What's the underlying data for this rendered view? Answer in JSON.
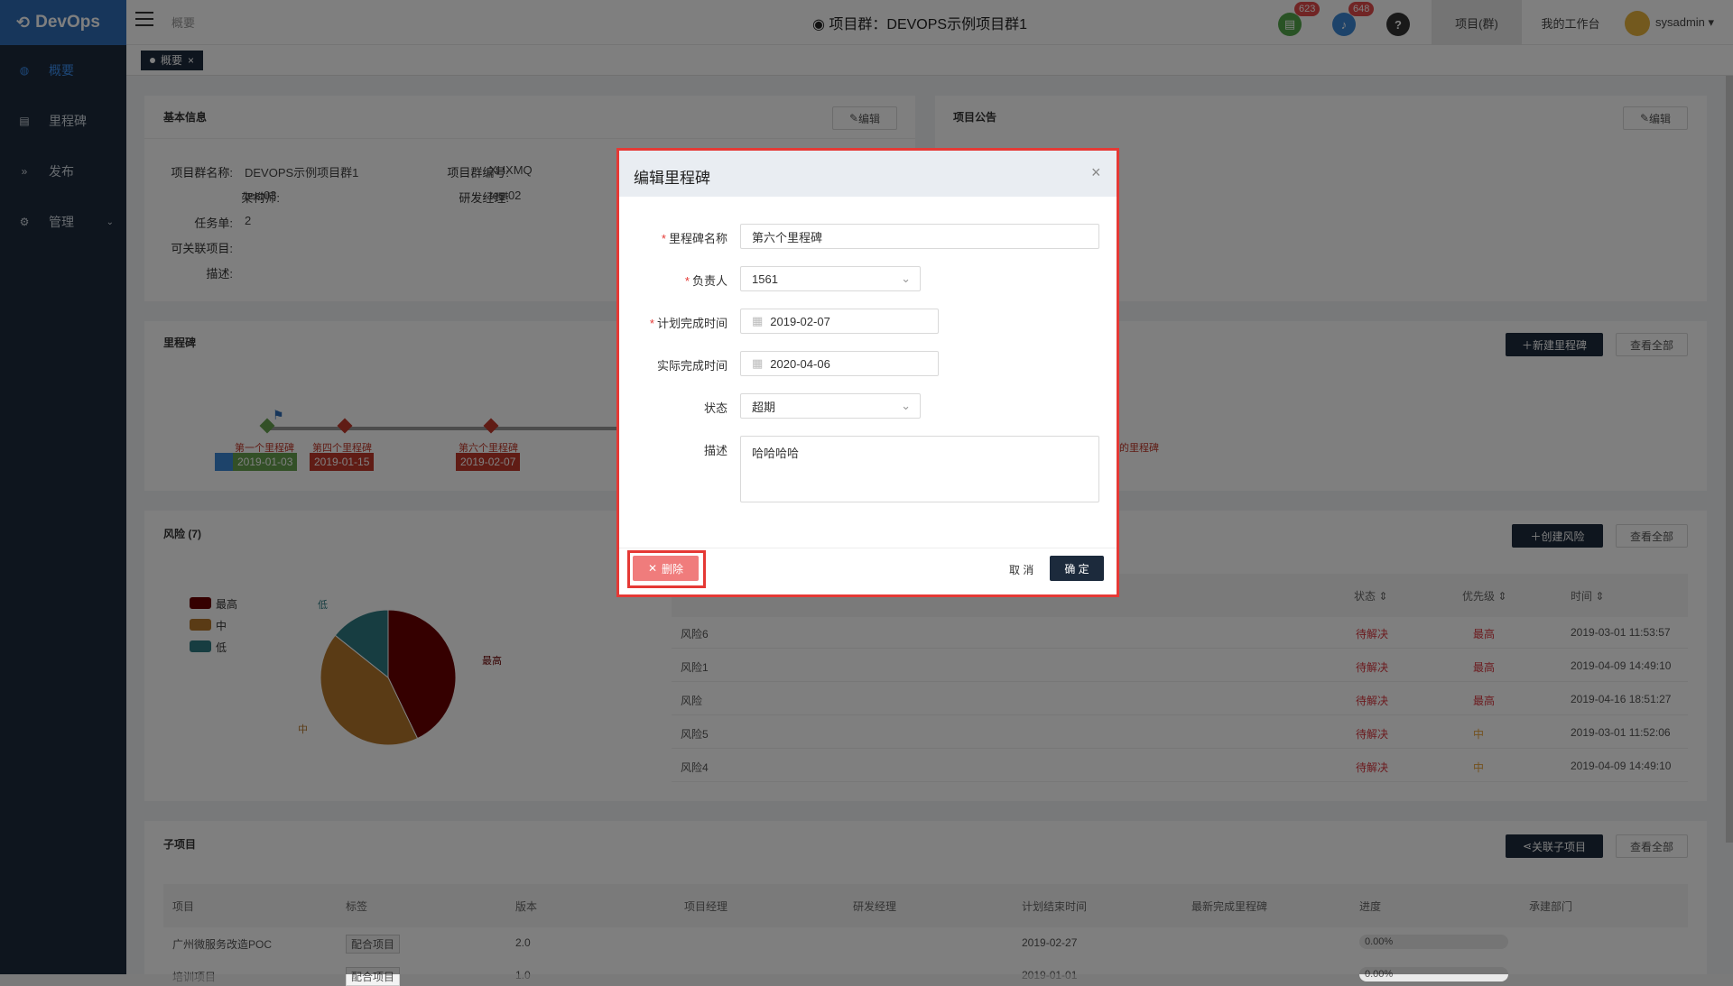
{
  "app": {
    "name": "DevOps"
  },
  "header": {
    "breadcrumb": "概要",
    "title": "项目群：DEVOPS示例项目群1",
    "doc_badge": "623",
    "bell_badge": "648",
    "help": "?",
    "nav_project_group": "项目(群)",
    "nav_workbench": "我的工作台",
    "user": "sysadmin"
  },
  "sidebar": {
    "items": [
      {
        "label": "概要",
        "icon": "dashboard-icon"
      },
      {
        "label": "里程碑",
        "icon": "calendar-icon"
      },
      {
        "label": "发布",
        "icon": "forward-icon"
      },
      {
        "label": "管理",
        "icon": "gear-icon"
      }
    ]
  },
  "tabs": {
    "active": "概要",
    "close": "×"
  },
  "basic_info": {
    "title": "基本信息",
    "edit": "编辑",
    "fields": {
      "name_label": "项目群名称:",
      "name_value": "DEVOPS示例项目群1",
      "code_label": "项目群编号:",
      "code_value": "XHXMQ",
      "architect_label": "架构师:",
      "architect_value": "test03",
      "manager_label": "研发经理:",
      "manager_value": "test02",
      "tasks_label": "任务单:",
      "tasks_value": "2",
      "linkable_label": "可关联项目:",
      "desc_label": "描述:"
    }
  },
  "announcement": {
    "title": "项目公告",
    "edit": "编辑"
  },
  "milestones": {
    "title": "里程碑",
    "new_button": "新建里程碑",
    "view_all": "查看全部",
    "items": [
      {
        "name": "第一个里程碑",
        "date": "2019-01-03"
      },
      {
        "name": "第四个里程碑",
        "date": "2019-01-15"
      },
      {
        "name": "第六个里程碑",
        "date": "2019-02-07"
      }
    ],
    "right_label": "的里程碑"
  },
  "risk": {
    "title": "风险 (7)",
    "create_button": "创建风险",
    "view_all": "查看全部",
    "legend": [
      {
        "name": "最高",
        "color": "#6b0000"
      },
      {
        "name": "中",
        "color": "#b5762a"
      },
      {
        "name": "低",
        "color": "#2f7b83"
      }
    ],
    "pie_labels": {
      "high": "最高",
      "mid": "中",
      "low": "低"
    },
    "columns": {
      "status": "状态",
      "priority": "优先级",
      "time": "时间"
    },
    "rows": [
      {
        "name": "风险6",
        "status": "待解决",
        "priority": "最高",
        "time": "2019-03-01 11:53:57"
      },
      {
        "name": "风险1",
        "status": "待解决",
        "priority": "最高",
        "time": "2019-04-09 14:49:10"
      },
      {
        "name": "风险",
        "status": "待解决",
        "priority": "最高",
        "time": "2019-04-16 18:51:27"
      },
      {
        "name": "风险5",
        "status": "待解决",
        "priority": "中",
        "time": "2019-03-01 11:52:06"
      },
      {
        "name": "风险4",
        "status": "待解决",
        "priority": "中",
        "time": "2019-04-09 14:49:10"
      }
    ]
  },
  "chart_data": {
    "type": "pie",
    "slices": [
      {
        "label": "最高",
        "value": 3,
        "color": "#6b0000"
      },
      {
        "label": "中",
        "value": 3,
        "color": "#b5762a"
      },
      {
        "label": "低",
        "value": 1,
        "color": "#2f7b83"
      }
    ]
  },
  "subprojects": {
    "title": "子项目",
    "link_button": "关联子项目",
    "view_all": "查看全部",
    "columns": [
      "项目",
      "标签",
      "版本",
      "项目经理",
      "研发经理",
      "计划结束时间",
      "最新完成里程碑",
      "进度",
      "承建部门"
    ],
    "rows": [
      {
        "name": "广州微服务改造POC",
        "tag": "配合项目",
        "version": "2.0",
        "end": "2019-02-27",
        "progress": "0.00%"
      },
      {
        "name": "培训项目",
        "tag": "配合项目",
        "version": "1.0",
        "end": "2019-01-01",
        "progress": "0.00%"
      }
    ]
  },
  "modal": {
    "title": "编辑里程碑",
    "close": "×",
    "name_label": "里程碑名称",
    "name_value": "第六个里程碑",
    "owner_label": "负责人",
    "owner_value": "1561",
    "plan_label": "计划完成时间",
    "plan_value": "2019-02-07",
    "actual_label": "实际完成时间",
    "actual_value": "2020-04-06",
    "status_label": "状态",
    "status_value": "超期",
    "desc_label": "描述",
    "desc_value": "哈哈哈哈",
    "delete": "删除",
    "cancel": "取 消",
    "confirm": "确 定"
  }
}
